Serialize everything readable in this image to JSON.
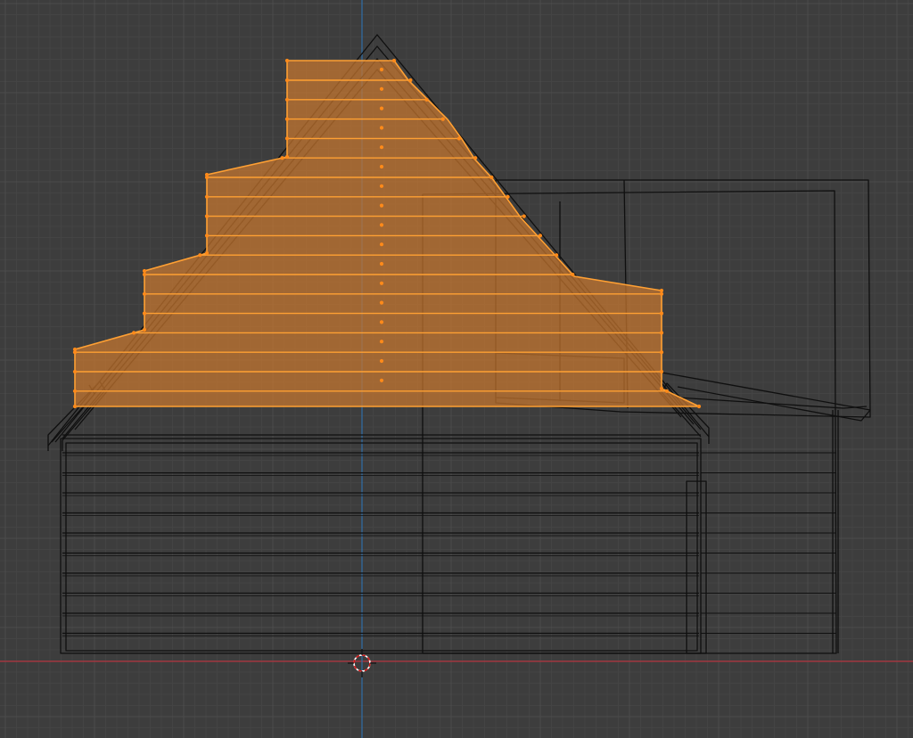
{
  "viewport": {
    "view": "orthographic-front",
    "edit_mode": "edit-mesh",
    "object": "house-wireframe",
    "selected_mesh": "gable-siding",
    "colors": {
      "background": "#3d3d3d",
      "grid_minor": "#444444",
      "grid_major": "#4b4b4b",
      "x_axis": "#b3343f",
      "z_axis": "#2f6ea8",
      "wire": "#0f0f0f",
      "selection_fill": "#c7772f",
      "selection_edge": "#ffa033",
      "selection_vertex": "#ff8a1a",
      "cursor_ring": "#ffffff",
      "cursor_dash": "#d01818"
    },
    "icons": {
      "cursor": "3d-cursor-icon",
      "vertex": "vertex-dot-icon"
    }
  }
}
